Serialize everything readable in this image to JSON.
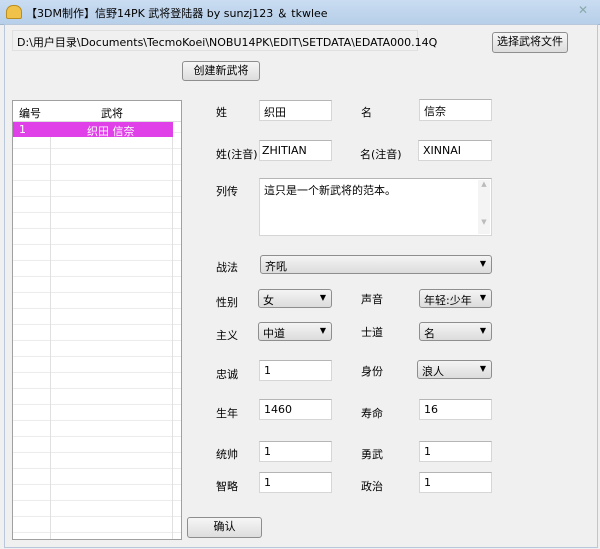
{
  "window": {
    "title": "【3DM制作】信野14PK 武将登陆器 by sunzj123 ＆ tkwlee",
    "close": "✕"
  },
  "toolbar": {
    "path": "D:\\用户目录\\Documents\\TecmoKoei\\NOBU14PK\\EDIT\\SETDATA\\EDATA000.14Q",
    "choose_file": "选择武将文件",
    "create_new": "创建新武将",
    "confirm": "确认"
  },
  "list": {
    "columns": [
      "编号",
      "武将"
    ],
    "rows": [
      {
        "id": "1",
        "name": "织田 信奈"
      }
    ],
    "selected_color": "#e040e8"
  },
  "form": {
    "surname_label": "姓",
    "surname": "织田",
    "given_label": "名",
    "given": "信奈",
    "surname_reading_label": "姓(注音)",
    "surname_reading": "ZHITIAN",
    "given_reading_label": "名(注音)",
    "given_reading": "XINNAI",
    "bio_label": "列传",
    "bio": "這只是一个新武将的范本。",
    "tactic_label": "战法",
    "tactic": "齐吼",
    "gender_label": "性别",
    "gender": "女",
    "voice_label": "声音",
    "voice": "年轻:少年",
    "doctrine_label": "主义",
    "doctrine": "中道",
    "bushido_label": "士道",
    "bushido": "名",
    "loyalty_label": "忠诚",
    "loyalty": "1",
    "status_label": "身份",
    "status": "浪人",
    "birth_label": "生年",
    "birth": "1460",
    "lifespan_label": "寿命",
    "lifespan": "16",
    "leadership_label": "统帅",
    "leadership": "1",
    "valor_label": "勇武",
    "valor": "1",
    "intellect_label": "智略",
    "intellect": "1",
    "politics_label": "政治",
    "politics": "1"
  }
}
